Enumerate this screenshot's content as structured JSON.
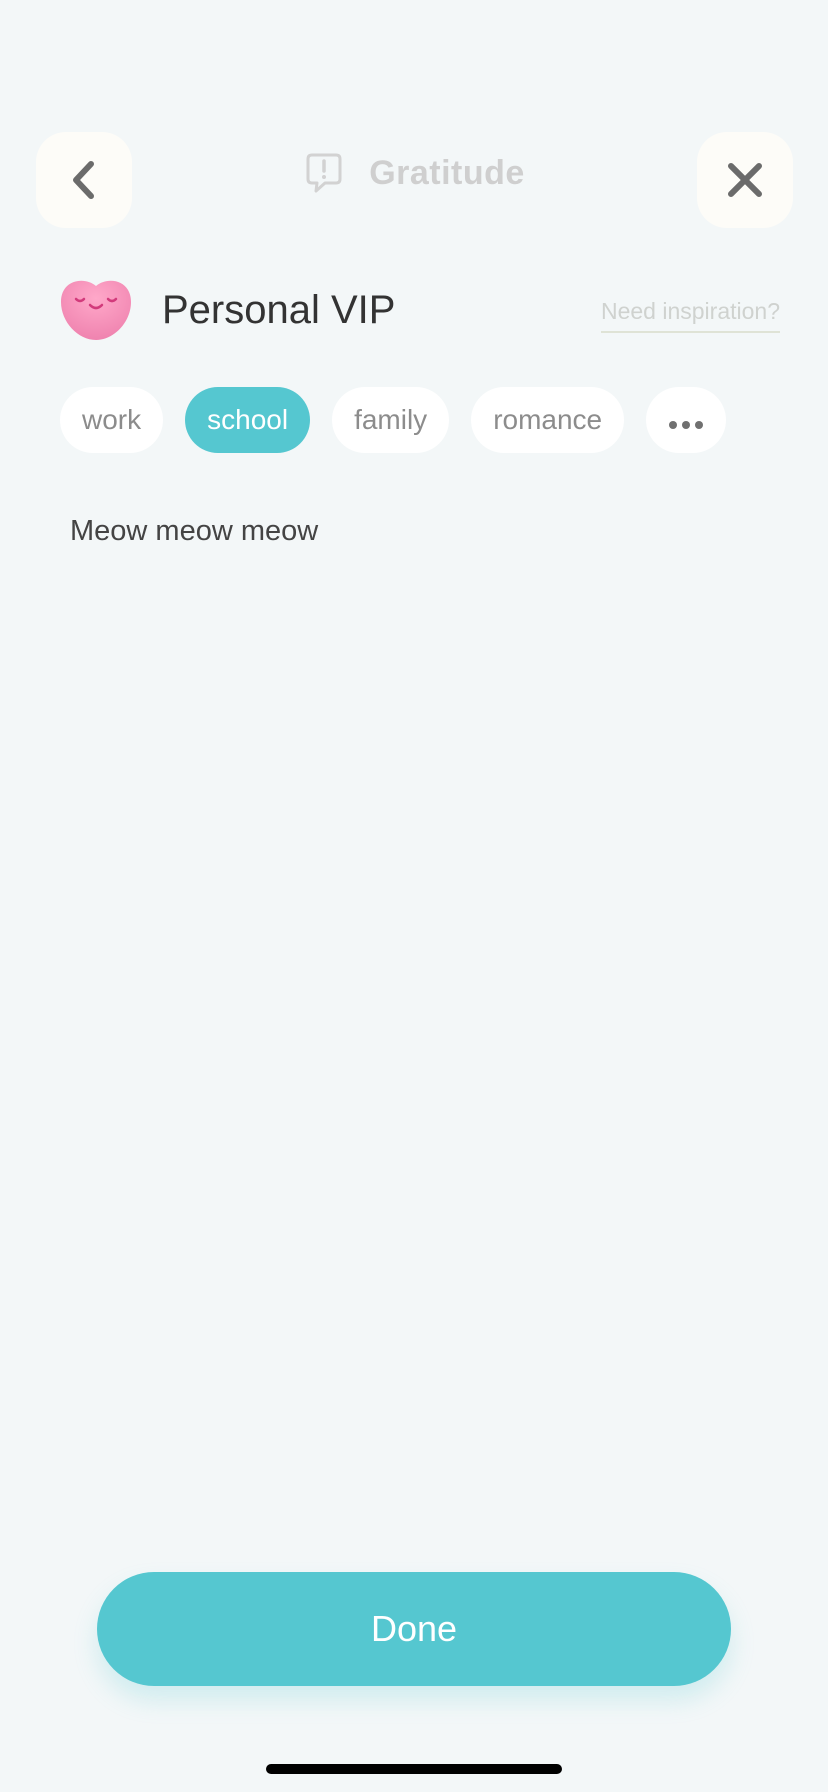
{
  "header": {
    "back_icon": "chevron-left-icon",
    "close_icon": "close-icon",
    "title_icon": "speech-bubble-exclamation-icon",
    "title": "Gratitude"
  },
  "mood": {
    "icon": "pink-heart-face-icon",
    "label": "Personal VIP",
    "inspiration_link": "Need inspiration?"
  },
  "tags": [
    {
      "label": "work",
      "selected": false
    },
    {
      "label": "school",
      "selected": true
    },
    {
      "label": "family",
      "selected": false
    },
    {
      "label": "romance",
      "selected": false
    }
  ],
  "more_tags_icon": "more-dots-icon",
  "entry": {
    "text": "Meow meow meow"
  },
  "footer": {
    "done_label": "Done"
  },
  "colors": {
    "accent": "#55c7d0",
    "background": "#f3f7f8",
    "button_surface": "#fdfcf8",
    "mood_pink": "#f28fb7"
  }
}
